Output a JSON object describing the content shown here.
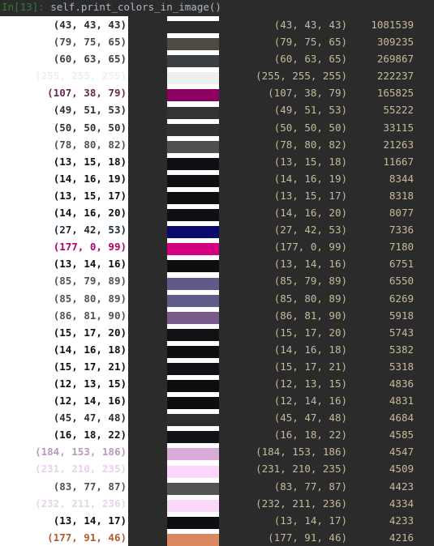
{
  "prompt": "In[13]:",
  "command": " self.print_colors_in_image()",
  "colors": [
    {
      "rgb": "(43, 43, 43)",
      "hex": "#2b2b2b",
      "count": "1081539"
    },
    {
      "rgb": "(79, 75, 65)",
      "hex": "#4f4b41",
      "count": "309235"
    },
    {
      "rgb": "(60, 63, 65)",
      "hex": "#3c3f41",
      "count": "269867"
    },
    {
      "rgb": "(255, 255, 255)",
      "hex": "#eeeeee",
      "count": "222237"
    },
    {
      "rgb": "(107, 38, 79)",
      "hex": "#8b0060",
      "count": "165825"
    },
    {
      "rgb": "(49, 51, 53)",
      "hex": "#313335",
      "count": "55222"
    },
    {
      "rgb": "(50, 50, 50)",
      "hex": "#323232",
      "count": "33115"
    },
    {
      "rgb": "(78, 80, 82)",
      "hex": "#4e5052",
      "count": "21263"
    },
    {
      "rgb": "(13, 15, 18)",
      "hex": "#0d0f12",
      "count": "11667"
    },
    {
      "rgb": "(14, 16, 19)",
      "hex": "#0e1013",
      "count": "8344"
    },
    {
      "rgb": "(13, 15, 17)",
      "hex": "#0d0f11",
      "count": "8318"
    },
    {
      "rgb": "(14, 16, 20)",
      "hex": "#0e1014",
      "count": "8077"
    },
    {
      "rgb": "(27, 42, 53)",
      "hex": "#0a0a6a",
      "count": "7336"
    },
    {
      "rgb": "(177, 0, 99)",
      "hex": "#d4007f",
      "count": "7180"
    },
    {
      "rgb": "(13, 14, 16)",
      "hex": "#0d0e10",
      "count": "6751"
    },
    {
      "rgb": "(85, 79, 89)",
      "hex": "#5f5a88",
      "count": "6550"
    },
    {
      "rgb": "(85, 80, 89)",
      "hex": "#605c8a",
      "count": "6269"
    },
    {
      "rgb": "(86, 81, 90)",
      "hex": "#7a5a8a",
      "count": "5918"
    },
    {
      "rgb": "(15, 17, 20)",
      "hex": "#0f1114",
      "count": "5743"
    },
    {
      "rgb": "(14, 16, 18)",
      "hex": "#0e1012",
      "count": "5382"
    },
    {
      "rgb": "(15, 17, 21)",
      "hex": "#0f1115",
      "count": "5318"
    },
    {
      "rgb": "(12, 13, 15)",
      "hex": "#0c0d0f",
      "count": "4836"
    },
    {
      "rgb": "(12, 14, 16)",
      "hex": "#0c0e10",
      "count": "4831"
    },
    {
      "rgb": "(45, 47, 48)",
      "hex": "#2d2f30",
      "count": "4684"
    },
    {
      "rgb": "(16, 18, 22)",
      "hex": "#101216",
      "count": "4585"
    },
    {
      "rgb": "(184, 153, 186)",
      "hex": "#d8aad8",
      "count": "4547"
    },
    {
      "rgb": "(231, 210, 235)",
      "hex": "#fdd8fd",
      "count": "4509"
    },
    {
      "rgb": "(83, 77, 87)",
      "hex": "#535353",
      "count": "4423"
    },
    {
      "rgb": "(232, 211, 236)",
      "hex": "#fdd8fd",
      "count": "4334"
    },
    {
      "rgb": "(13, 14, 17)",
      "hex": "#0d0e11",
      "count": "4233"
    },
    {
      "rgb": "(177, 91, 46)",
      "hex": "#d8875e",
      "count": "4216"
    }
  ]
}
